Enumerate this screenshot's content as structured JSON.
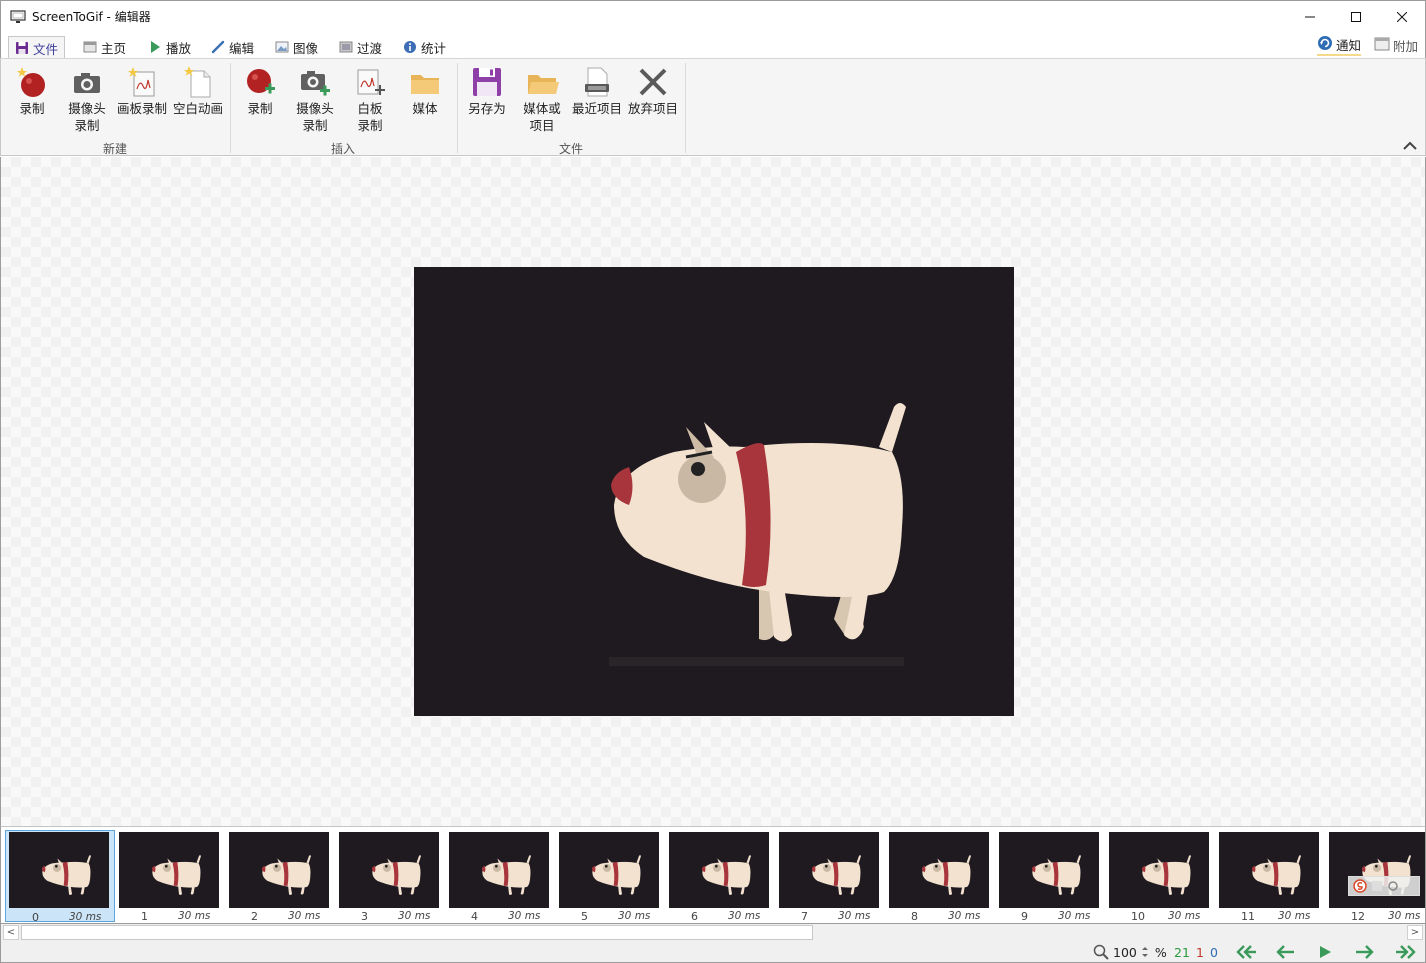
{
  "window": {
    "title": "ScreenToGif - 编辑器",
    "minimize_icon": "minimize-icon",
    "maximize_icon": "maximize-icon",
    "close_icon": "close-icon"
  },
  "tabs": [
    {
      "label": "文件",
      "icon": "save-icon",
      "active": true
    },
    {
      "label": "主页",
      "icon": "home-icon"
    },
    {
      "label": "播放",
      "icon": "play-icon"
    },
    {
      "label": "编辑",
      "icon": "pencil-icon"
    },
    {
      "label": "图像",
      "icon": "image-icon"
    },
    {
      "label": "过渡",
      "icon": "transition-icon"
    },
    {
      "label": "统计",
      "icon": "info-icon"
    }
  ],
  "right_tabs": {
    "notify": "通知",
    "extras": "附加"
  },
  "ribbon": {
    "groups": [
      {
        "label": "新建",
        "buttons": [
          {
            "label": "录制",
            "icon": "record-icon"
          },
          {
            "label": "摄像头\n录制",
            "line1": "摄像头",
            "line2": "录制",
            "icon": "webcam-icon"
          },
          {
            "label": "画板录制",
            "icon": "board-icon"
          },
          {
            "label": "空白动画",
            "icon": "blank-file-icon"
          }
        ]
      },
      {
        "label": "插入",
        "buttons": [
          {
            "label": "录制",
            "icon": "record-add-icon"
          },
          {
            "line1": "摄像头",
            "line2": "录制",
            "icon": "webcam-add-icon"
          },
          {
            "line1": "白板",
            "line2": "录制",
            "icon": "board-add-icon"
          },
          {
            "label": "媒体",
            "icon": "folder-icon"
          }
        ]
      },
      {
        "label": "文件",
        "buttons": [
          {
            "label": "另存为",
            "icon": "floppy-icon"
          },
          {
            "line1": "媒体或",
            "line2": "项目",
            "icon": "folder-open-icon"
          },
          {
            "label": "最近项目",
            "icon": "recent-projects-icon"
          },
          {
            "label": "放弃项目",
            "icon": "discard-icon"
          }
        ]
      }
    ]
  },
  "colors": {
    "accent": "#6a2c91",
    "record_red": "#b22222",
    "frame_bg": "#1f1a20",
    "dog_body": "#f2e2cf",
    "dog_collar": "#a8353b"
  },
  "frames": [
    {
      "index": "0",
      "duration": "30 ms"
    },
    {
      "index": "1",
      "duration": "30 ms"
    },
    {
      "index": "2",
      "duration": "30 ms"
    },
    {
      "index": "3",
      "duration": "30 ms"
    },
    {
      "index": "4",
      "duration": "30 ms"
    },
    {
      "index": "5",
      "duration": "30 ms"
    },
    {
      "index": "6",
      "duration": "30 ms"
    },
    {
      "index": "7",
      "duration": "30 ms"
    },
    {
      "index": "8",
      "duration": "30 ms"
    },
    {
      "index": "9",
      "duration": "30 ms"
    },
    {
      "index": "10",
      "duration": "30 ms"
    },
    {
      "index": "11",
      "duration": "30 ms"
    },
    {
      "index": "12",
      "duration": "30 ms"
    }
  ],
  "status": {
    "zoom": "100",
    "zoom_unit": "%",
    "frame_count": "21",
    "selected_count": "1",
    "current_index": "0"
  },
  "scroll": {
    "left_arrow": "<",
    "right_arrow": ">"
  }
}
